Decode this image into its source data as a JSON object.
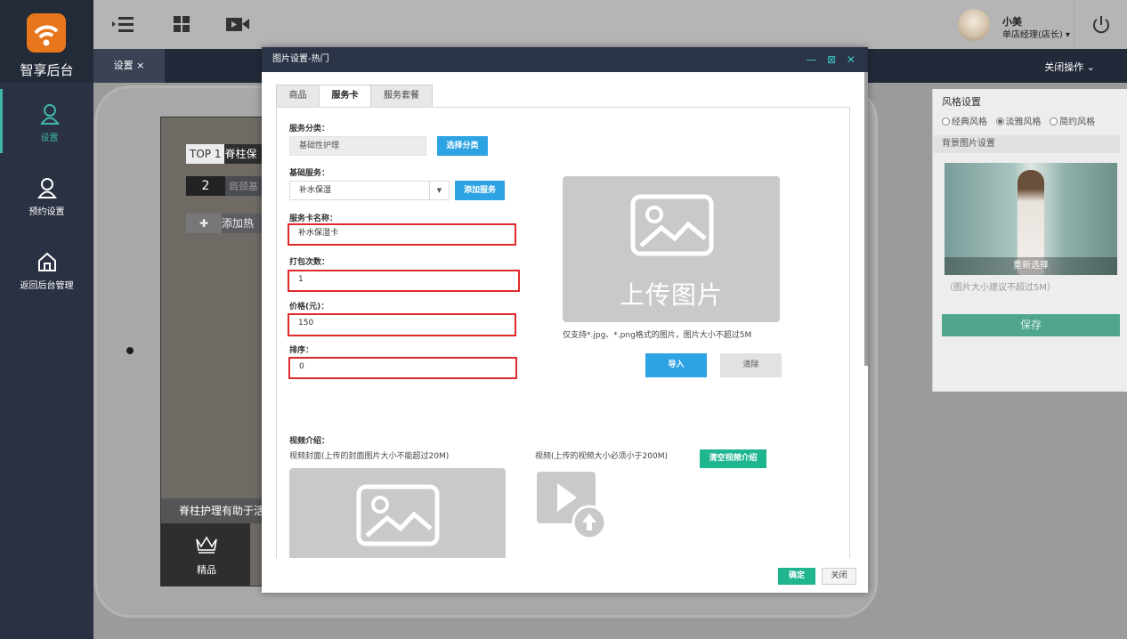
{
  "app": {
    "logo_text": "智享后台",
    "brand_color": "#e8761c"
  },
  "sidebar": {
    "items": [
      {
        "label": "设置",
        "icon": "user-icon",
        "active": true
      },
      {
        "label": "预约设置",
        "icon": "user-icon",
        "active": false
      },
      {
        "label": "返回后台管理",
        "icon": "home-icon",
        "active": false
      }
    ]
  },
  "topbar": {
    "icons": [
      "menu-collapse-icon",
      "grid-icon",
      "video-icon"
    ],
    "user_name": "小美",
    "user_role": "单店经理(店长) ▾",
    "power_icon": "power-icon"
  },
  "tabbar": {
    "tab": "设置 ×",
    "close_ops": "关闭操作 ⌄"
  },
  "preview": {
    "top1_label": "TOP 1",
    "top1_text": "脊柱保",
    "row2_num": "2",
    "row2_text": "肩颈基",
    "add_plus": "✚",
    "add_hot": "添加热",
    "caption": "脊柱护理有助于活",
    "nav_label": "精品"
  },
  "right_panel": {
    "title": "风格设置",
    "styles": [
      {
        "label": "经典风格",
        "checked": false
      },
      {
        "label": "淡雅风格",
        "checked": true
      },
      {
        "label": "简约风格",
        "checked": false
      }
    ],
    "bg_title": "背景图片设置",
    "reselect": "重新选择",
    "size_hint": "（图片大小建议不超过5M）",
    "save": "保存"
  },
  "modal": {
    "title": "图片设置-热门",
    "controls": "— ⊠ ✕",
    "tabs": [
      {
        "label": "商品",
        "active": false
      },
      {
        "label": "服务卡",
        "active": true
      },
      {
        "label": "服务套餐",
        "active": false
      }
    ],
    "service_category_label": "服务分类：",
    "service_category_value": "基础性护理",
    "select_category_btn": "选择分类",
    "base_service_label": "基础服务：",
    "base_service_value": "补水保湿",
    "add_service_btn": "添加服务",
    "card_name_label": "服务卡名称：",
    "card_name_value": "补水保湿卡",
    "pack_count_label": "打包次数：",
    "pack_count_value": "1",
    "price_label": "价格(元)：",
    "price_value": "150",
    "sort_label": "排序：",
    "sort_value": "0",
    "upload_text": "上传图片",
    "image_hint": "仅支持*.jpg、*.png格式的图片，图片大小不超过5M",
    "import_btn": "导入",
    "clear_btn": "清除",
    "video_intro_label": "视频介绍：",
    "video_cover_hint": "视频封面(上传的封面图片大小不能超过20M)",
    "video_hint": "视频(上传的视频大小必须小于200M)",
    "clear_video_btn": "清空视频介绍",
    "ok_btn": "确定",
    "close_btn": "关闭"
  }
}
